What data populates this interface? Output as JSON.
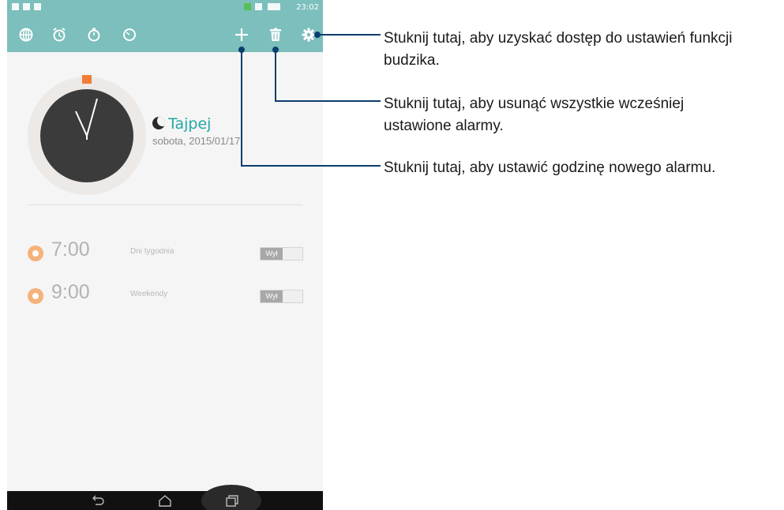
{
  "status_bar": {
    "time": "23:02"
  },
  "action_bar": {
    "icons": [
      "world-clock-icon",
      "alarm-icon",
      "stopwatch-icon",
      "timer-icon",
      "add-icon",
      "delete-icon",
      "settings-icon"
    ]
  },
  "world_clock": {
    "city": "Tajpej",
    "date": "sobota, 2015/01/17"
  },
  "alarms": [
    {
      "time": "7:00",
      "label": "Dni tygodnia",
      "toggle": "Wył"
    },
    {
      "time": "9:00",
      "label": "Weekendy",
      "toggle": "Wył"
    }
  ],
  "callouts": {
    "settings": "Stuknij tutaj, aby uzyskać dostęp do ustawień funkcji budzika.",
    "delete": "Stuknij tutaj, aby usunąć wszystkie wcześniej ustawione alarmy.",
    "add": "Stuknij tutaj, aby ustawić godzinę nowego alarmu."
  },
  "colors": {
    "accent": "#7cbfbc",
    "city": "#25a8a3",
    "alarm_icon": "#f5b27a",
    "leader": "#0b3e6e"
  }
}
